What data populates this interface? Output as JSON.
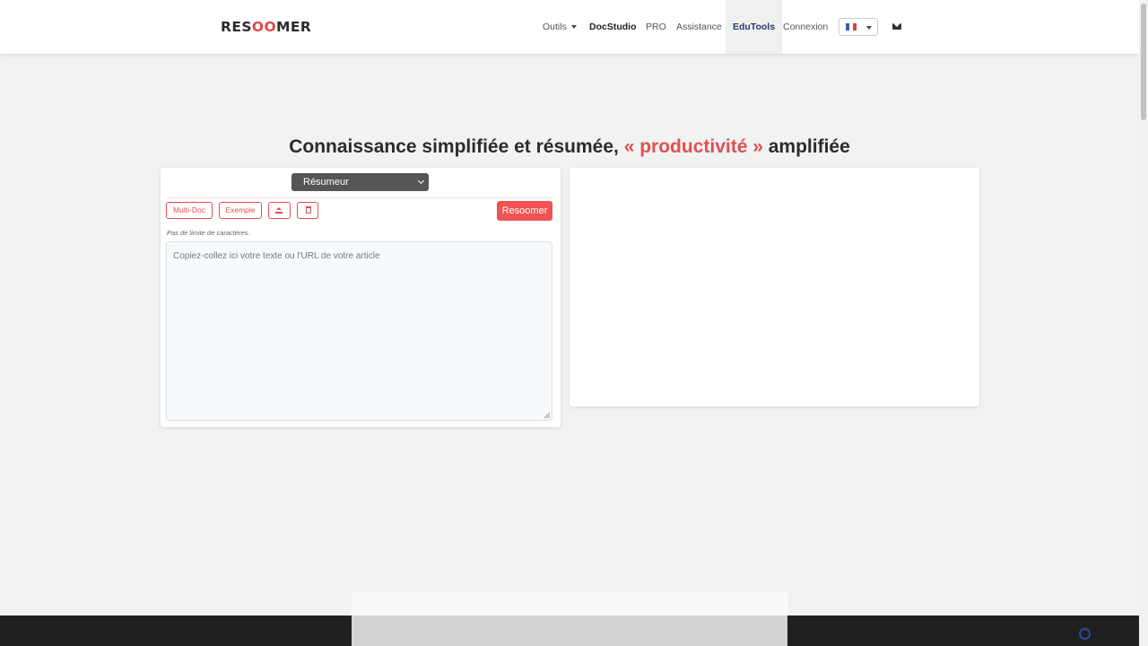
{
  "brand": {
    "prefix": "RES",
    "highlight": "OO",
    "suffix": "MER"
  },
  "nav": {
    "outils": "Outils",
    "docstudio": "DocStudio",
    "pro": "PRO",
    "assistance": "Assistance",
    "edutools": "EduTools",
    "connexion": "Connexion"
  },
  "headline": {
    "before": "Connaissance simplifiée et résumée,",
    "accent": "« productivité »",
    "after": "amplifiée"
  },
  "tool": {
    "selected": "Résumeur",
    "multidoc": "Multi-Doc",
    "exemple": "Exemple",
    "submit": "Resoomer",
    "hint": "Pas de limite de caractères.",
    "placeholder": "Copiez-collez ici votre texte ou l'URL de votre article"
  },
  "colors": {
    "accent": "#e05050",
    "button": "#f05353",
    "edutools": "#1f3b70"
  },
  "icons": [
    "upload-icon",
    "trash-icon",
    "mail-icon",
    "flag-fr-icon",
    "caret-down-icon"
  ]
}
